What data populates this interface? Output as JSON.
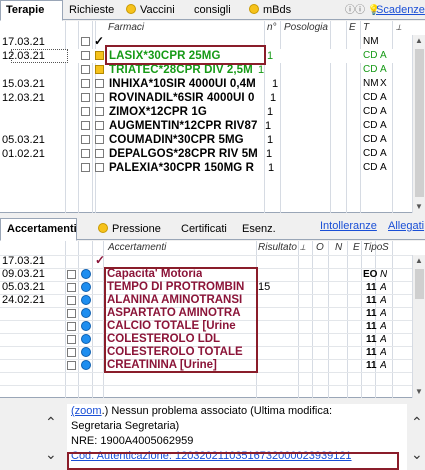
{
  "top_tabs": {
    "terapie": "Terapie",
    "richieste": "Richieste",
    "vaccini": "Vaccini",
    "consigli": "consigli",
    "mbds": "mBds",
    "scadenze": "Scadenze"
  },
  "farmaci": {
    "headers": {
      "farmaci": "Farmaci",
      "n": "n°",
      "posologia": "Posologia",
      "e": "E",
      "t": "T"
    },
    "rows": [
      {
        "date": "17.03.21",
        "drug": "",
        "n": "",
        "t": "NM",
        "x": ""
      },
      {
        "date": "12.03.21",
        "drug": "LASIX*30CPR 25MG",
        "n": "1",
        "t": "CD",
        "x": "A"
      },
      {
        "date": "",
        "drug": "TRIATEC*28CPR DIV 2,5M",
        "n": "1",
        "t": "CD",
        "x": "A"
      },
      {
        "date": "15.03.21",
        "drug": "INHIXA*10SIR 4000UI 0,4M",
        "n": "1",
        "t": "NM",
        "x": "X"
      },
      {
        "date": "12.03.21",
        "drug": "ROVINADIL*6SIR 4000UI 0",
        "n": "1",
        "t": "CD",
        "x": "A"
      },
      {
        "date": "",
        "drug": "ZIMOX*12CPR 1G",
        "n": "1",
        "t": "CD",
        "x": "A"
      },
      {
        "date": "",
        "drug": "AUGMENTIN*12CPR RIV87",
        "n": "1",
        "t": "CD",
        "x": "A"
      },
      {
        "date": "05.03.21",
        "drug": "COUMADIN*30CPR 5MG",
        "n": "1",
        "t": "CD",
        "x": "A"
      },
      {
        "date": "01.02.21",
        "drug": "DEPALGOS*28CPR RIV 5M",
        "n": "1",
        "t": "CD",
        "x": "A"
      },
      {
        "date": "",
        "drug": "PALEXIA*30CPR 150MG R",
        "n": "1",
        "t": "CD",
        "x": "A"
      }
    ]
  },
  "mid_tabs": {
    "accertamenti": "Accertamenti",
    "pressione": "Pressione",
    "certificati": "Certificati",
    "esenz": "Esenz.",
    "intolleranze": "Intolleranze",
    "allegati": "Allegati"
  },
  "accertamenti": {
    "headers": {
      "accertamenti": "Accertamenti",
      "risultato": "Risultato",
      "o": "O",
      "n": "N",
      "e": "E",
      "tipo": "Tipo",
      "s": "S"
    },
    "rows": [
      {
        "date": "17.03.21",
        "name": "",
        "result": "",
        "tipo": "",
        "s": ""
      },
      {
        "date": "09.03.21",
        "name": "Capacita' Motoria",
        "result": "",
        "tipo": "EO",
        "s": "N"
      },
      {
        "date": "05.03.21",
        "name": "TEMPO DI PROTROMBIN",
        "result": "15",
        "tipo": "11",
        "s": "A"
      },
      {
        "date": "24.02.21",
        "name": "ALANINA AMINOTRANSI",
        "result": "",
        "tipo": "11",
        "s": "A"
      },
      {
        "date": "",
        "name": "ASPARTATO AMINOTRA",
        "result": "",
        "tipo": "11",
        "s": "A"
      },
      {
        "date": "",
        "name": "CALCIO TOTALE [Urine",
        "result": "",
        "tipo": "11",
        "s": "A"
      },
      {
        "date": "",
        "name": "COLESTEROLO LDL",
        "result": "",
        "tipo": "11",
        "s": "A"
      },
      {
        "date": "",
        "name": "COLESTEROLO TOTALE",
        "result": "",
        "tipo": "11",
        "s": "A"
      },
      {
        "date": "",
        "name": "CREATININA [Urine]",
        "result": "",
        "tipo": "11",
        "s": "A"
      }
    ]
  },
  "notes": {
    "zoom": "(zoom",
    "text1": ".) Nessun problema associato (Ultima modifica:",
    "text2": "Segretaria Segretaria)",
    "nre": "NRE: 1900A4005062959",
    "auth": "Cod. Autenticazione: 12032021103516732000023939121"
  }
}
